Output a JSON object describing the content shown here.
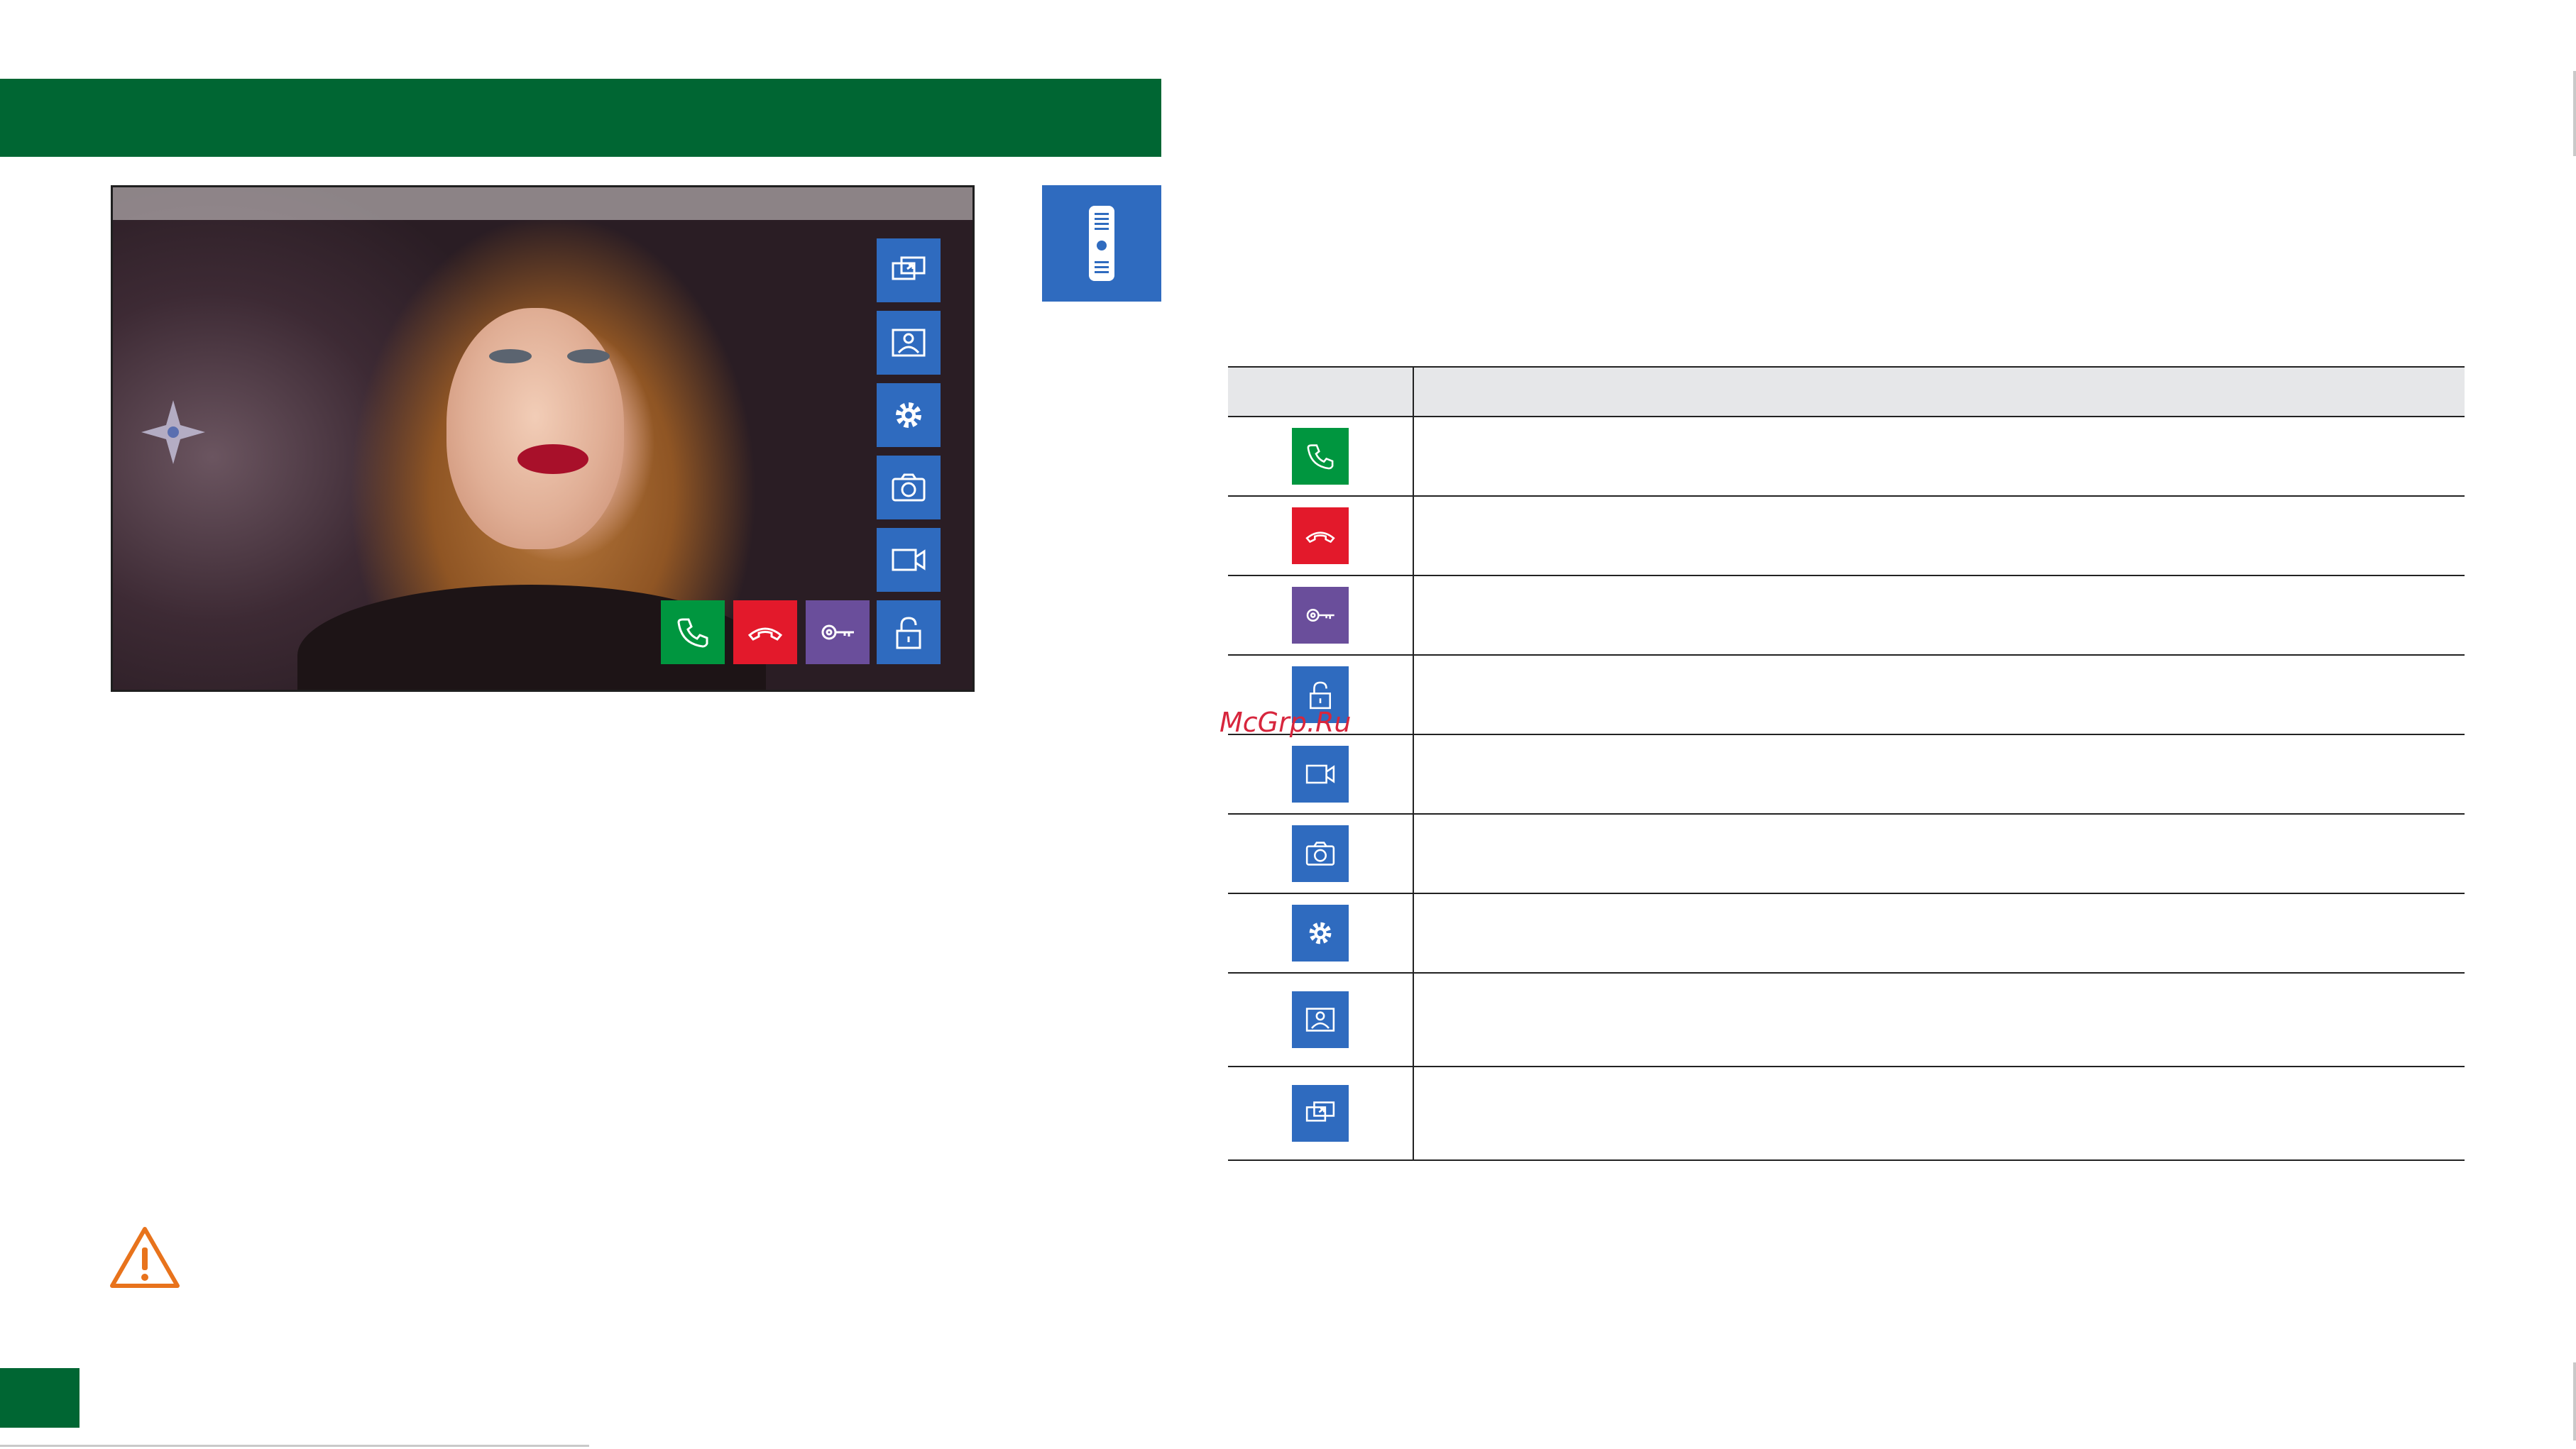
{
  "colors": {
    "brand_green": "#006633",
    "accept_green": "#00963f",
    "reject_red": "#e3192b",
    "key_purple": "#6a4e9b",
    "ui_blue": "#2f6bbf"
  },
  "watermark": "McGrp.Ru",
  "monitor": {
    "side_buttons": [
      {
        "icon": "monitor-switch-icon"
      },
      {
        "icon": "gallery-icon"
      },
      {
        "icon": "gear-icon"
      },
      {
        "icon": "camera-icon"
      },
      {
        "icon": "video-record-icon"
      }
    ],
    "bottom_buttons": [
      {
        "icon": "phone-accept-icon",
        "color": "#00963f"
      },
      {
        "icon": "phone-hangup-icon",
        "color": "#e3192b"
      },
      {
        "icon": "key-icon",
        "color": "#6a4e9b"
      },
      {
        "icon": "unlock-icon",
        "color": "#2f6bbf"
      }
    ]
  },
  "table": {
    "header": [
      "",
      ""
    ],
    "rows": [
      {
        "icon": "phone-accept-icon",
        "color": "#00963f",
        "description": ""
      },
      {
        "icon": "phone-hangup-icon",
        "color": "#e3192b",
        "description": ""
      },
      {
        "icon": "key-icon",
        "color": "#6a4e9b",
        "description": ""
      },
      {
        "icon": "unlock-icon",
        "color": "#2f6bbf",
        "description": ""
      },
      {
        "icon": "video-record-icon",
        "color": "#2f6bbf",
        "description": ""
      },
      {
        "icon": "camera-icon",
        "color": "#2f6bbf",
        "description": ""
      },
      {
        "icon": "gear-icon",
        "color": "#2f6bbf",
        "description": ""
      },
      {
        "icon": "gallery-icon",
        "color": "#2f6bbf",
        "description": ""
      },
      {
        "icon": "monitor-switch-icon",
        "color": "#2f6bbf",
        "description": ""
      }
    ]
  }
}
